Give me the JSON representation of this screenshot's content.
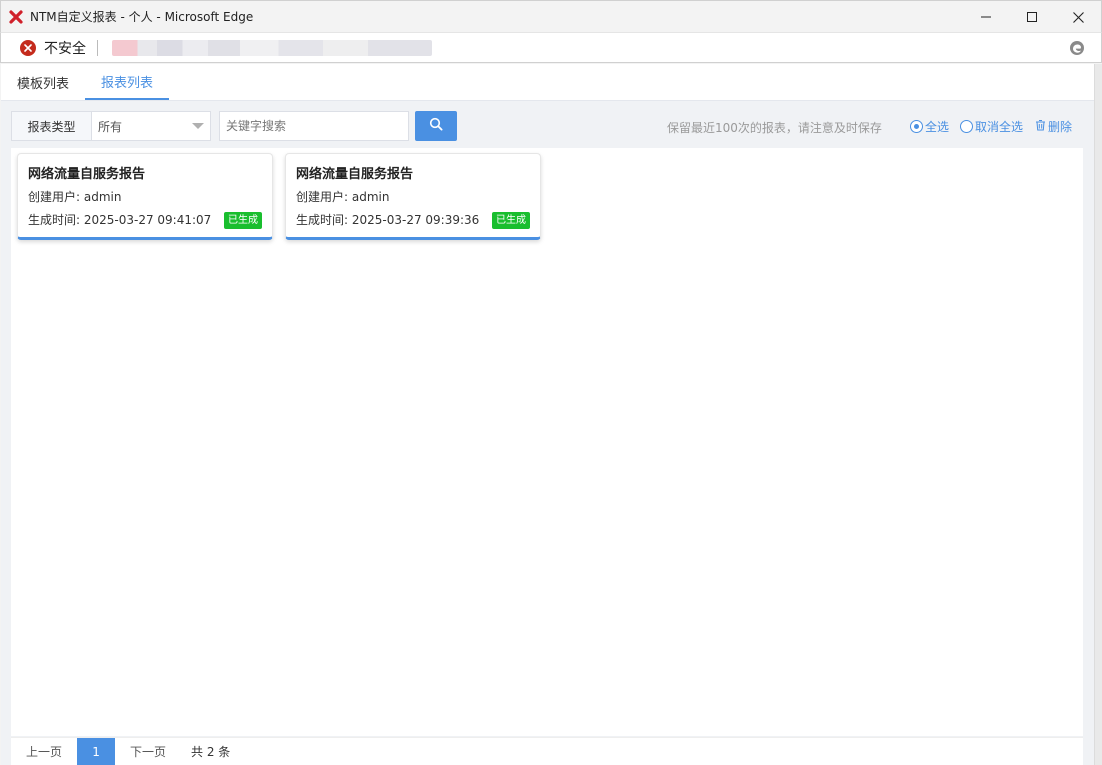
{
  "window": {
    "title": "NTM自定义报表 - 个人 - Microsoft Edge",
    "minimize_icon": "minimize-icon",
    "maximize_icon": "maximize-icon",
    "close_icon": "close-icon"
  },
  "addressbar": {
    "security_label": "不安全",
    "security_icon": "insecure-x-icon",
    "security_color": "#c42b1c"
  },
  "tabs": [
    {
      "label": "模板列表",
      "active": false
    },
    {
      "label": "报表列表",
      "active": true
    }
  ],
  "toolbar": {
    "type_label": "报表类型",
    "type_value": "所有",
    "search_placeholder": "关键字搜索",
    "notice": "保留最近100次的报表，请注意及时保存",
    "select_all": "全选",
    "deselect_all": "取消全选",
    "delete": "删除"
  },
  "reports": [
    {
      "title": "网络流量自服务报告",
      "user_label": "创建用户: ",
      "user": "admin",
      "time_label": "生成时间: ",
      "time": "2025-03-27 09:41:07",
      "status": "已生成"
    },
    {
      "title": "网络流量自服务报告",
      "user_label": "创建用户: ",
      "user": "admin",
      "time_label": "生成时间: ",
      "time": "2025-03-27 09:39:36",
      "status": "已生成"
    }
  ],
  "pager": {
    "prev": "上一页",
    "current": "1",
    "next": "下一页",
    "total": "共 2 条"
  },
  "colors": {
    "accent": "#4a90e2",
    "status_ok": "#19be2e"
  }
}
